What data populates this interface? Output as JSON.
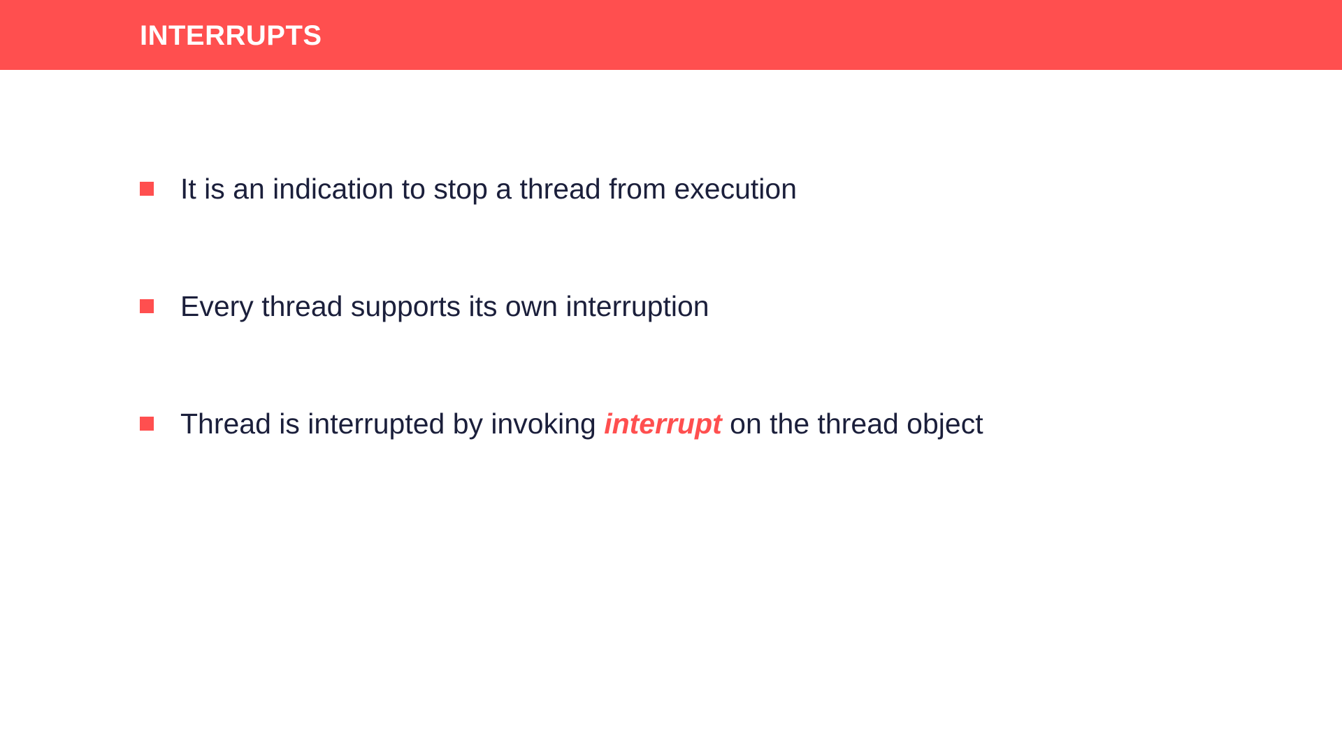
{
  "header": {
    "title": "INTERRUPTS"
  },
  "bullets": [
    {
      "text": "It is an indication to stop a thread from execution"
    },
    {
      "text": "Every thread supports its own interruption"
    },
    {
      "text_before": "Thread is interrupted by invoking ",
      "emphasis": "interrupt",
      "text_after": " on the thread object"
    }
  ],
  "colors": {
    "accent": "#ff4f4f",
    "text": "#1b1f3b",
    "background": "#ffffff",
    "header_text": "#ffffff"
  },
  "icons": {
    "bullet": "square-bullet-icon"
  }
}
